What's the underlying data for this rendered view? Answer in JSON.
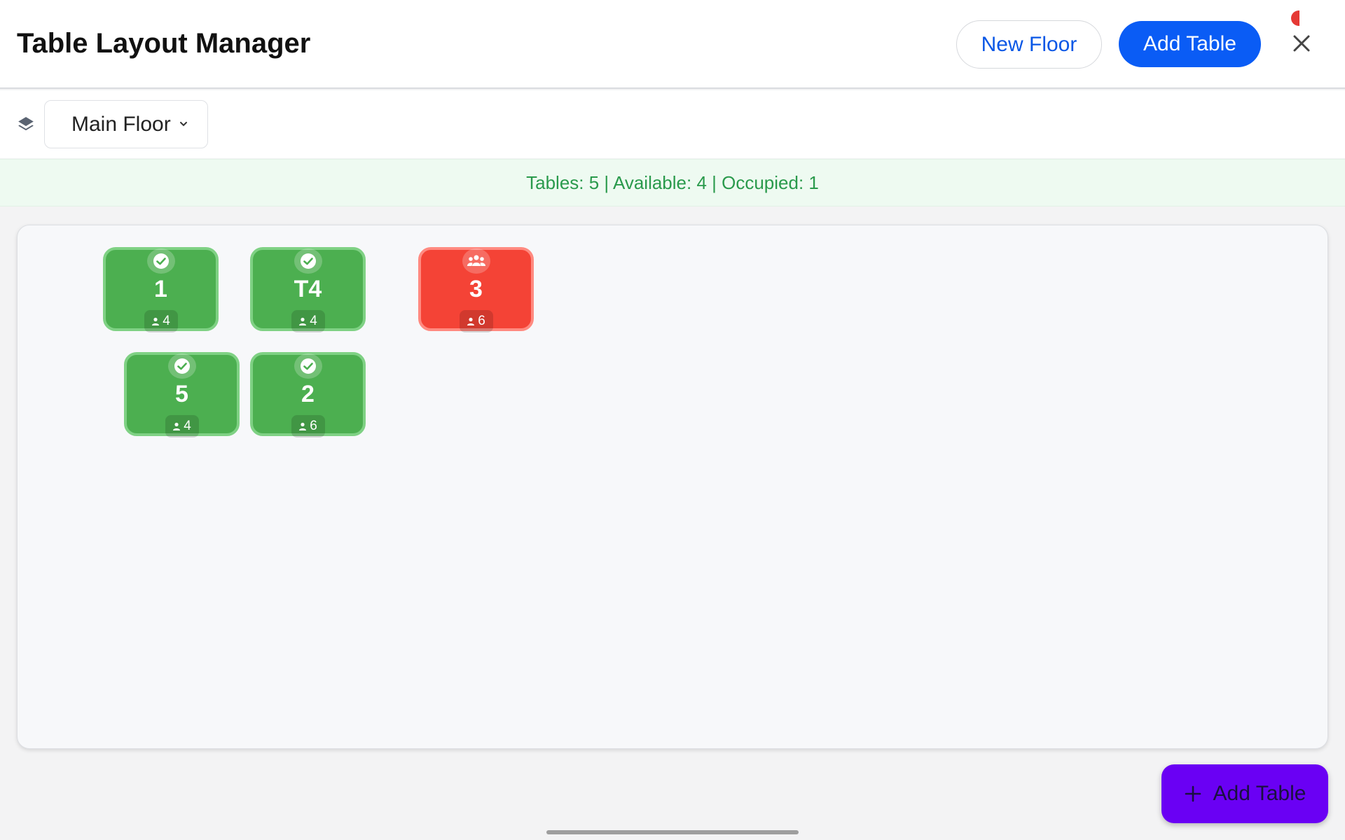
{
  "header": {
    "title": "Table Layout Manager",
    "new_floor_label": "New Floor",
    "add_table_label": "Add Table"
  },
  "floor": {
    "selected": "Main Floor"
  },
  "stats": {
    "text": "Tables: 5 | Available: 4 | Occupied: 1"
  },
  "tables": [
    {
      "name": "1",
      "seats": "4",
      "status": "available"
    },
    {
      "name": "T4",
      "seats": "4",
      "status": "available"
    },
    {
      "name": "3",
      "seats": "6",
      "status": "occupied"
    },
    {
      "name": "5",
      "seats": "4",
      "status": "available"
    },
    {
      "name": "2",
      "seats": "6",
      "status": "available"
    }
  ],
  "fab": {
    "label": "Add Table"
  },
  "colors": {
    "primary": "#0a5cf5",
    "available": "#4caf50",
    "occupied": "#f44336",
    "fab": "#6a00f4",
    "stats_text": "#2a9a4c"
  }
}
